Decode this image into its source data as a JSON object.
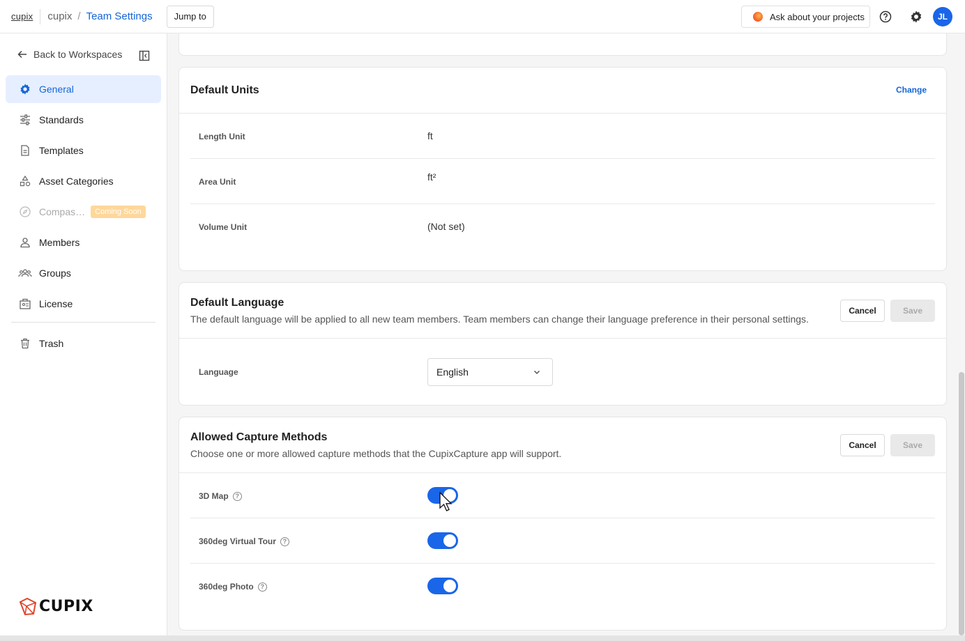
{
  "topbar": {
    "logo_text": "cupix",
    "breadcrumb_root": "cupix",
    "breadcrumb_sep": "/",
    "breadcrumb_current": "Team Settings",
    "jump_label": "Jump to",
    "ask_label": "Ask about your projects",
    "avatar_initials": "JL"
  },
  "sidebar": {
    "back_label": "Back to Workspaces",
    "items": [
      {
        "label": "General",
        "icon": "gear-icon",
        "active": true
      },
      {
        "label": "Standards",
        "icon": "sliders-icon"
      },
      {
        "label": "Templates",
        "icon": "document-icon"
      },
      {
        "label": "Asset Categories",
        "icon": "shapes-icon"
      },
      {
        "label": "Compas…",
        "icon": "compass-icon",
        "disabled": true,
        "badge": "Coming Soon"
      },
      {
        "label": "Members",
        "icon": "person-icon"
      },
      {
        "label": "Groups",
        "icon": "group-icon"
      },
      {
        "label": "License",
        "icon": "license-icon"
      },
      {
        "label": "Trash",
        "icon": "trash-icon"
      }
    ],
    "brand": "CUPIX"
  },
  "units": {
    "title": "Default Units",
    "change_label": "Change",
    "rows": [
      {
        "label": "Length Unit",
        "value": "ft"
      },
      {
        "label": "Area Unit",
        "value": "ft²"
      },
      {
        "label": "Volume Unit",
        "value": "(Not set)"
      }
    ]
  },
  "language": {
    "title": "Default Language",
    "description": "The default language will be applied to all new team members. Team members can change their language preference in their personal settings.",
    "cancel_label": "Cancel",
    "save_label": "Save",
    "field_label": "Language",
    "selected": "English"
  },
  "capture": {
    "title": "Allowed Capture Methods",
    "description": "Choose one or more allowed capture methods that the CupixCapture app will support.",
    "cancel_label": "Cancel",
    "save_label": "Save",
    "methods": [
      {
        "label": "3D Map",
        "enabled": true
      },
      {
        "label": "360deg Virtual Tour",
        "enabled": true
      },
      {
        "label": "360deg Photo",
        "enabled": true
      }
    ]
  },
  "colors": {
    "accent": "#1565d8",
    "toggle_on": "#1a66e8",
    "badge": "#ffd79a"
  }
}
